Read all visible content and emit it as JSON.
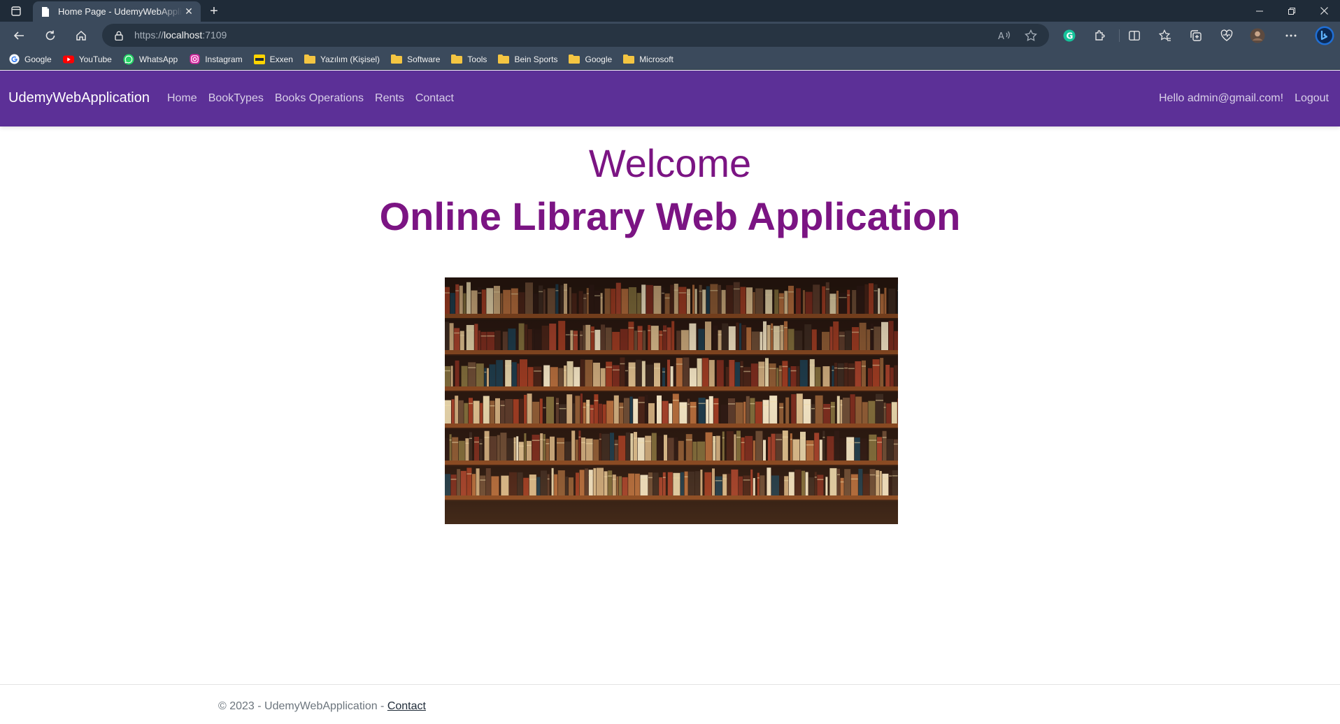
{
  "browser": {
    "tab_title": "Home Page - UdemyWebApplication",
    "url_prefix": "https://",
    "url_host": "localhost",
    "url_port": ":7109"
  },
  "bookmarks": [
    {
      "label": "Google",
      "icon": "google-icon"
    },
    {
      "label": "YouTube",
      "icon": "youtube-icon"
    },
    {
      "label": "WhatsApp",
      "icon": "whatsapp-icon"
    },
    {
      "label": "Instagram",
      "icon": "instagram-icon"
    },
    {
      "label": "Exxen",
      "icon": "exxen-icon"
    },
    {
      "label": "Yazılım (Kişisel)",
      "icon": "folder-icon"
    },
    {
      "label": "Software",
      "icon": "folder-icon"
    },
    {
      "label": "Tools",
      "icon": "folder-icon"
    },
    {
      "label": "Bein Sports",
      "icon": "folder-icon"
    },
    {
      "label": "Google",
      "icon": "folder-icon"
    },
    {
      "label": "Microsoft",
      "icon": "folder-icon"
    }
  ],
  "navbar": {
    "brand": "UdemyWebApplication",
    "links": [
      "Home",
      "BookTypes",
      "Books Operations",
      "Rents",
      "Contact"
    ],
    "greeting": "Hello admin@gmail.com!",
    "logout": "Logout",
    "color": "#5c3097"
  },
  "main": {
    "welcome": "Welcome",
    "subtitle": "Online Library Web Application",
    "heading_color": "#7b1483"
  },
  "footer": {
    "text": "© 2023 - UdemyWebApplication - ",
    "contact_link": "Contact"
  }
}
